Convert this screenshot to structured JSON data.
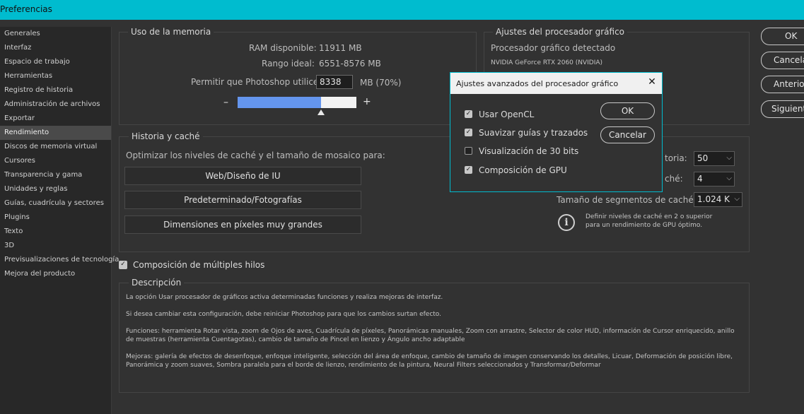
{
  "window": {
    "title": "Preferencias"
  },
  "sidebar": {
    "items": [
      {
        "label": "Generales"
      },
      {
        "label": "Interfaz"
      },
      {
        "label": "Espacio de trabajo"
      },
      {
        "label": "Herramientas"
      },
      {
        "label": "Registro de historia"
      },
      {
        "label": "Administración de archivos"
      },
      {
        "label": "Exportar"
      },
      {
        "label": "Rendimiento"
      },
      {
        "label": "Discos de memoria virtual"
      },
      {
        "label": "Cursores"
      },
      {
        "label": "Transparencia y gama"
      },
      {
        "label": "Unidades y reglas"
      },
      {
        "label": "Guías, cuadrícula y sectores"
      },
      {
        "label": "Plugins"
      },
      {
        "label": "Texto"
      },
      {
        "label": "3D"
      },
      {
        "label": "Previsualizaciones de tecnología"
      },
      {
        "label": "Mejora del producto"
      }
    ],
    "active_index": 7
  },
  "memory": {
    "title": "Uso de la memoria",
    "ram_label": "RAM disponible:",
    "ram_value": "11911 MB",
    "range_label": "Rango ideal:",
    "range_value": "6551-8576 MB",
    "allow_label": "Permitir que Photoshop utilice:",
    "allow_value": "8338",
    "allow_unit": "MB (70%)",
    "minus": "–",
    "plus": "+",
    "slider_fraction": 0.7
  },
  "gpu": {
    "title": "Ajustes del procesador gráfico",
    "detected_label": "Procesador gráfico detectado",
    "detected_value": "NVIDIA GeForce RTX 2060 (NVIDIA)"
  },
  "history_cache": {
    "title": "Historia y caché",
    "optimize_label": "Optimizar los niveles de caché y el tamaño de mosaico para:",
    "buttons": [
      {
        "label": "Web/Diseño de IU"
      },
      {
        "label": "Predeterminado/Fotografías"
      },
      {
        "label": "Dimensiones en píxeles muy grandes"
      }
    ],
    "history_states_label": "toria:",
    "history_states_value": "50",
    "cache_levels_label": "ché:",
    "cache_levels_value": "4",
    "tile_size_label": "Tamaño de segmentos de caché:",
    "tile_size_value": "1.024 K",
    "info_text": "Definir niveles de caché en 2 o superior para un rendimiento de GPU óptimo."
  },
  "multithread": {
    "label": "Composición de múltiples hilos",
    "checked": true
  },
  "description": {
    "title": "Descripción",
    "lines": [
      "La opción Usar procesador de gráficos activa determinadas funciones y realiza mejoras de interfaz.",
      "Si desea cambiar esta configuración, debe reiniciar Photoshop para que los cambios surtan efecto.",
      "Funciones: herramienta Rotar vista, zoom de Ojos de aves, Cuadrícula de píxeles, Panorámicas manuales, Zoom con arrastre, Selector de color HUD, información de Cursor enriquecido, anillo de muestras (herramienta Cuentagotas), cambio de tamaño de Pincel en lienzo y Ángulo ancho adaptable",
      "Mejoras: galería de efectos de desenfoque, enfoque inteligente, selección del área de enfoque, cambio de tamaño de imagen conservando los detalles, Licuar, Deformación de posición libre, Panorámica y zoom suaves, Sombra paralela para el borde de lienzo, rendimiento de la pintura, Neural Filters seleccionados y Transformar/Deformar"
    ]
  },
  "right_buttons": {
    "ok": "OK",
    "cancel": "Cancelar",
    "prev": "Anterior",
    "next": "Siguiente"
  },
  "dialog": {
    "title": "Ajustes avanzados del procesador gráfico",
    "close": "✕",
    "options": [
      {
        "label": "Usar OpenCL",
        "checked": true
      },
      {
        "label": "Suavizar guías y trazados",
        "checked": true
      },
      {
        "label": "Visualización de 30 bits",
        "checked": false
      },
      {
        "label": "Composición de GPU",
        "checked": true
      }
    ],
    "ok": "OK",
    "cancel": "Cancelar"
  },
  "colors": {
    "titlebar": "#00bccf",
    "slider_fill": "#6495ed",
    "background": "#323232"
  }
}
